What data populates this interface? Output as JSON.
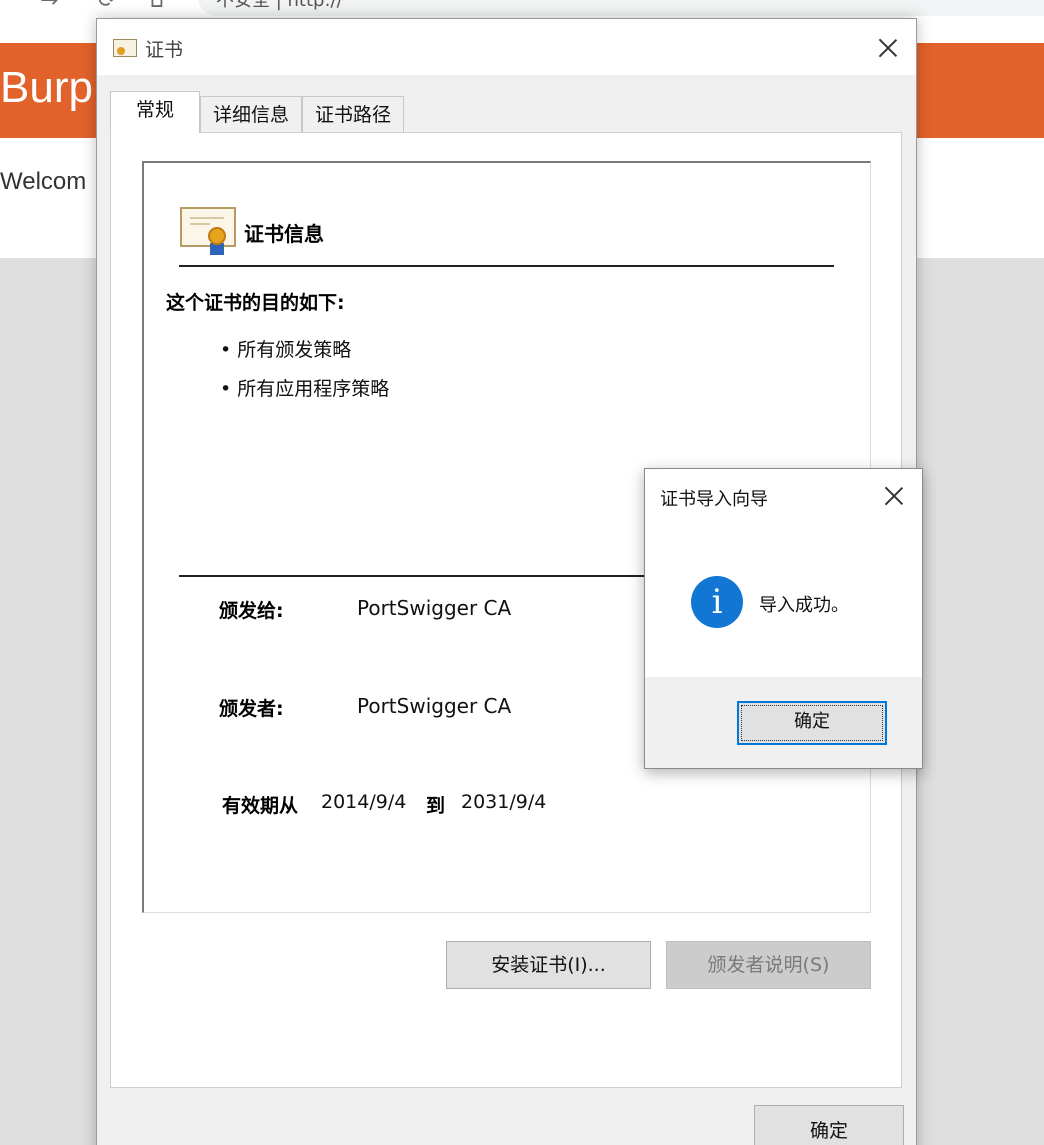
{
  "browser": {
    "address_fragment": "不安全 | http://"
  },
  "webpage": {
    "banner_title": "Burp",
    "welcome_text": "Welcom"
  },
  "certificate_dialog": {
    "title": "证书",
    "tabs": [
      {
        "label": "常规",
        "active": true
      },
      {
        "label": "详细信息",
        "active": false
      },
      {
        "label": "证书路径",
        "active": false
      }
    ],
    "info_heading": "证书信息",
    "purpose_heading": "这个证书的目的如下:",
    "purposes": [
      "• 所有颁发策略",
      "• 所有应用程序策略"
    ],
    "issued_to_label": "颁发给:",
    "issued_to_value": "PortSwigger CA",
    "issued_by_label": "颁发者:",
    "issued_by_value": "PortSwigger CA",
    "validity_label": "有效期从",
    "valid_from": "2014/9/4",
    "validity_to_word": "到",
    "valid_to": "2031/9/4",
    "install_button": "安装证书(I)...",
    "issuer_statement_button": "颁发者说明(S)",
    "ok_button": "确定"
  },
  "import_wizard": {
    "title": "证书导入向导",
    "message": "导入成功。",
    "ok_button": "确定",
    "icon": "info-icon",
    "icon_glyph": "i"
  },
  "colors": {
    "banner": "#e2622b",
    "info_icon": "#1177d3",
    "focus_border": "#0078d7"
  }
}
